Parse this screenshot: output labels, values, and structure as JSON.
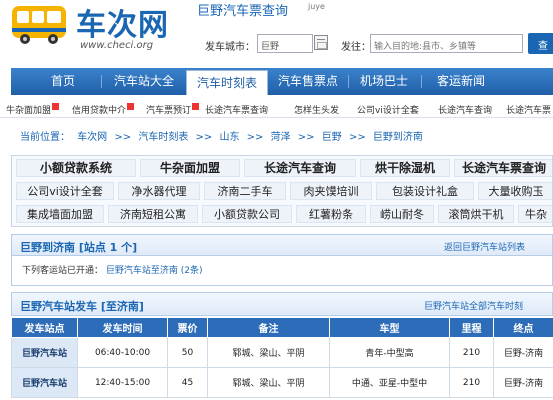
{
  "header": {
    "logo_text": "车次网",
    "logo_url": "www.checi.org",
    "site_title": "巨野汽车票查询",
    "site_title_suffix": "juye",
    "origin_label": "发车城市：",
    "origin_value": "巨野",
    "dest_label": "发往：",
    "dest_placeholder": "输入目的地:县市、乡镇等",
    "search_btn": "查"
  },
  "nav": {
    "items": [
      {
        "label": "首页"
      },
      {
        "label": "汽车站大全"
      },
      {
        "label": "汽车时刻表"
      },
      {
        "label": "汽车售票点"
      },
      {
        "label": "机场巴士"
      },
      {
        "label": "客运新闻"
      }
    ]
  },
  "subnav": {
    "items": [
      {
        "label": "牛杂面加盟"
      },
      {
        "label": "信用贷款中介"
      },
      {
        "label": "汽车票预订"
      },
      {
        "label": "长途汽车票查询"
      },
      {
        "label": "怎样生头发"
      },
      {
        "label": "公司vi设计全套"
      },
      {
        "label": "长途汽车查询"
      },
      {
        "label": "长途汽车票"
      }
    ]
  },
  "breadcrumb": {
    "prefix": "当前位置：",
    "items": [
      "车次网",
      "汽车时刻表",
      "山东",
      "菏泽",
      "巨野",
      "巨野到济南"
    ],
    "separator": ">>"
  },
  "ads": {
    "rows": [
      [
        "小额贷款系统",
        "牛杂面加盟",
        "长途汽车查询",
        "烘干除湿机",
        "长途汽车票查询"
      ],
      [
        "公司vi设计全套",
        "净水器代理",
        "济南二手车",
        "肉夹馍培训",
        "包装设计礼盒",
        "大量收购玉"
      ],
      [
        "集成墙面加盟",
        "济南短租公寓",
        "小额贷款公司",
        "红薯粉条",
        "崂山耐冬",
        "滚筒烘干机",
        "牛杂"
      ]
    ]
  },
  "route_panel": {
    "title": "巨野到济南 [站点 1 个]",
    "link": "返回巨野汽车站列表",
    "body_prefix": "下列客运站已开通：",
    "body_link": "巨野汽车站至济南",
    "body_count": "(2条)"
  },
  "schedule_panel": {
    "title": "巨野汽车站发车 [至济南]",
    "link": "巨野汽车站全部汽车时刻"
  },
  "schedule_table": {
    "headers": [
      "发车站点",
      "发车时间",
      "票价",
      "备注",
      "车型",
      "里程",
      "终点"
    ],
    "rows": [
      [
        "巨野汽车站",
        "06:40-10:00",
        "50",
        "郓城、梁山、平阴",
        "青年-中型高",
        "210",
        "巨野-济南"
      ],
      [
        "巨野汽车站",
        "12:40-15:00",
        "45",
        "郓城、梁山、平阴",
        "中通、亚星-中型中",
        "210",
        "巨野-济南"
      ]
    ]
  },
  "colors": {
    "brand_blue": "#1a66b3",
    "nav_blue": "#1f5fa8",
    "badge_red": "#e33333"
  }
}
